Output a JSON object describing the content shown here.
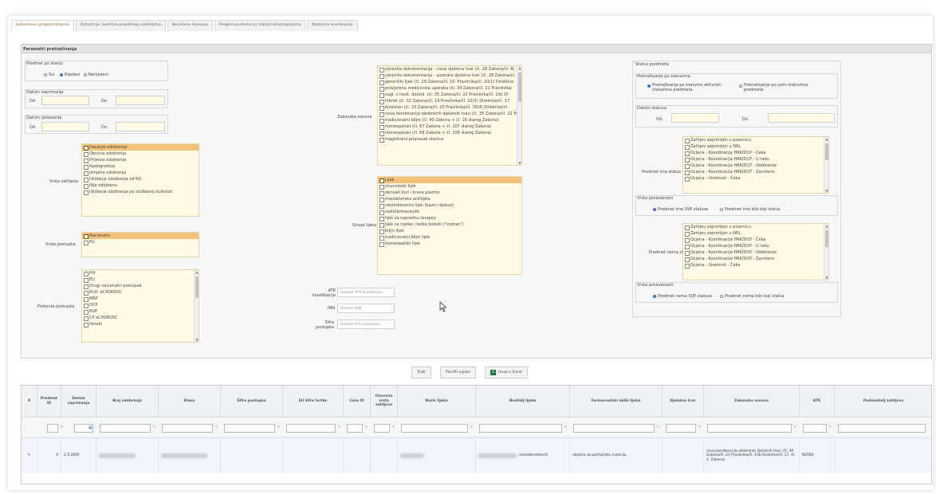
{
  "tabs": [
    "Jednostavni pregled zahtjeva",
    "Zaduženja i kontrola projektnog voditeljstva",
    "Nerješena mjerenja",
    "Pregled predmeta po stadijima/kategorijama",
    "Nadzorne koordinacije"
  ],
  "panel_title": "Parametri pretraživanja",
  "left": {
    "date_group_label": "Predmet po stanju",
    "radio_all": "Svi",
    "radio_solved": "Riješeni",
    "radio_unsolved": "Neriješeni",
    "date_recv_label": "Datum zaprimanja",
    "date_solve_label": "Datum rješavanja",
    "od": "Od",
    "do": "Do",
    "vrsta_zahtjeva_label": "Vrsta zahtjeva",
    "vrsta_zahtjeva_items": [
      "Davanje odobrenja",
      "Obnova odobrenja",
      "Prijenos odobrenja",
      "Nadogradnja",
      "Izmjene odobrenja",
      "Ukidanje odobrenja od NO",
      "Nije odobreno",
      "Ukidanje odobrenja po službenoj dužnosti"
    ],
    "vrsta_postupka_label": "Vrsta postupka",
    "vrsta_postupka_items": [
      "Nacionalni",
      "EU"
    ],
    "podvrsta_label": "Podvrsta postupka",
    "podvrsta_items": [
      "RH",
      "EU",
      "Drugi nacionalni postupak",
      "EnD: eCXORDSC",
      "MRP",
      "DCP",
      "RUP",
      "CP eCXORDSC",
      "Ostalo"
    ]
  },
  "middle": {
    "zakonska_label": "Zakonska osnova",
    "zakonska_items": [
      "cjelovita dokumentacija – nova djelatna tvar (čl. 28 Zakona/čl. 8(",
      "cjelovita dokumentacija – poznata djelatna tvar (čl. 28 Zakona/čl. 8(",
      "generički lijek (čl. 29 Zakona/čl. 10. Pravilnika/čl. 10(1) Direktive",
      "provjerena medicinska uporaba (čl. 34 Zakona/čl. 21 Pravilnika/",
      "sugl. s nosit. dozvol. (čl. 35 Zakona/čl. 22 Pravilnika/čl. 10c Di",
      "hibridi (čl. 32 Zakona/čl. 19 Pravilnika/čl. 10(3) Direktive/čl. 17",
      "biosličan (čl. 33 Zakona/čl. 20 Pravilnika/čl. 10(4) Direktive/čl.",
      "nova kombinacija odobrenih djelatnih tvari (čl. 35 Zakona/čl. 22 Pra",
      "tradicionalni biljni (čl. 40 Zakona + čl. 16 starog Zakona)",
      "homeopatski (čl. 67 Zakona + čl. 107 starog Zakona)",
      "homeopatski (čl. 68 Zakona + čl. 108 starog Zakona)",
      "magistralni pripravak stanica"
    ],
    "grupa_label": "Grupa lijeka",
    "grupa_items": [
      "Lijek",
      "imunološki lijek",
      "derivati krvi i krvne plazme",
      "monoklonska antitijela",
      "rekombinantni lijek (bazni rijekovi)",
      "radiofarmaceutik",
      "lijek za naprednu terapiju",
      "lijek za rijetke i teške bolesti (\"orphan\")",
      "biljni lijek",
      "tradicionalni biljni lijek",
      "homeopatski lijek"
    ],
    "atk_label": "ATK klasifikacija",
    "atk_placeholder": "Unesite ATK klasifikaciju",
    "inn_label": "INN",
    "inn_placeholder": "Unesite INN",
    "sifra_label": "Šifra postupka",
    "sifra_placeholder": "Unesite šifru postupka"
  },
  "right": {
    "status_group_label": "Status predmeta",
    "pretr_label": "Pretraživanje po statusima",
    "radio_current": "Pretraživanje po trenutno aktivnim statusima predmeta",
    "radio_all_statuses": "Pretraživanje po svim statusima predmeta",
    "datum_statusa_label": "Datum statusa",
    "od": "Od",
    "do": "Do",
    "ima_label": "Predmet ima status",
    "status_items": [
      "Zahtjev zaprimljen u pisarnicu",
      "Zahtjev zaprimljen u NRL",
      "Ocjena - Koordinacija HRK/DCP - Čeka",
      "Ocjena - Koordinacija HRK/DCP - U radu",
      "Ocjena - Koordinacija HRK/DCP - Odobrenje",
      "Ocjena - Koordinacija HRK/DCP - Završeno",
      "Ocjena - Urednost - Čeka"
    ],
    "vrsta_povezanosti_label": "Vrsta povezanosti",
    "ima_radio_1": "Predmet ima SVE statuse",
    "ima_radio_2": "Predmet ima bilo koji status",
    "nema_label": "Predmet nema status",
    "nema_radio_1": "Predmet nema SVE statuse",
    "nema_radio_2": "Predmet nema bilo koji status"
  },
  "buttons": {
    "search": "Traži",
    "reset": "Poništi uvjete",
    "export": "Izvoz u Excel"
  },
  "grid": {
    "columns": [
      "#",
      "Predmet ID",
      "Datum zaprimanja",
      "Broj odobrenja",
      "Klasa",
      "Šifra postupka",
      "EU šifra tvrtke",
      "Case ID",
      "Osnovna vrsta zahtjeva",
      "Naziv lijeka",
      "Nositelj lijeka",
      "Farmaceutski oblik lijeka",
      "Djelatna tvar",
      "Zakonska osnova",
      "ATK",
      "Podnositelj zahtjeva"
    ],
    "row": {
      "id": "4",
      "date": "2.5.2005",
      "djelatna": "amiodaronklorid",
      "oblik": "otopina za perfuzijsku injekciju",
      "zakonska": "nova kombinacija odobrenih djelatnih tvari (čl. 30 Zakona/čl. 22 Pravilnika/čl. 10b Direktive/čl. 17. st. 2. Zakona)",
      "atk": "N05BA"
    }
  }
}
